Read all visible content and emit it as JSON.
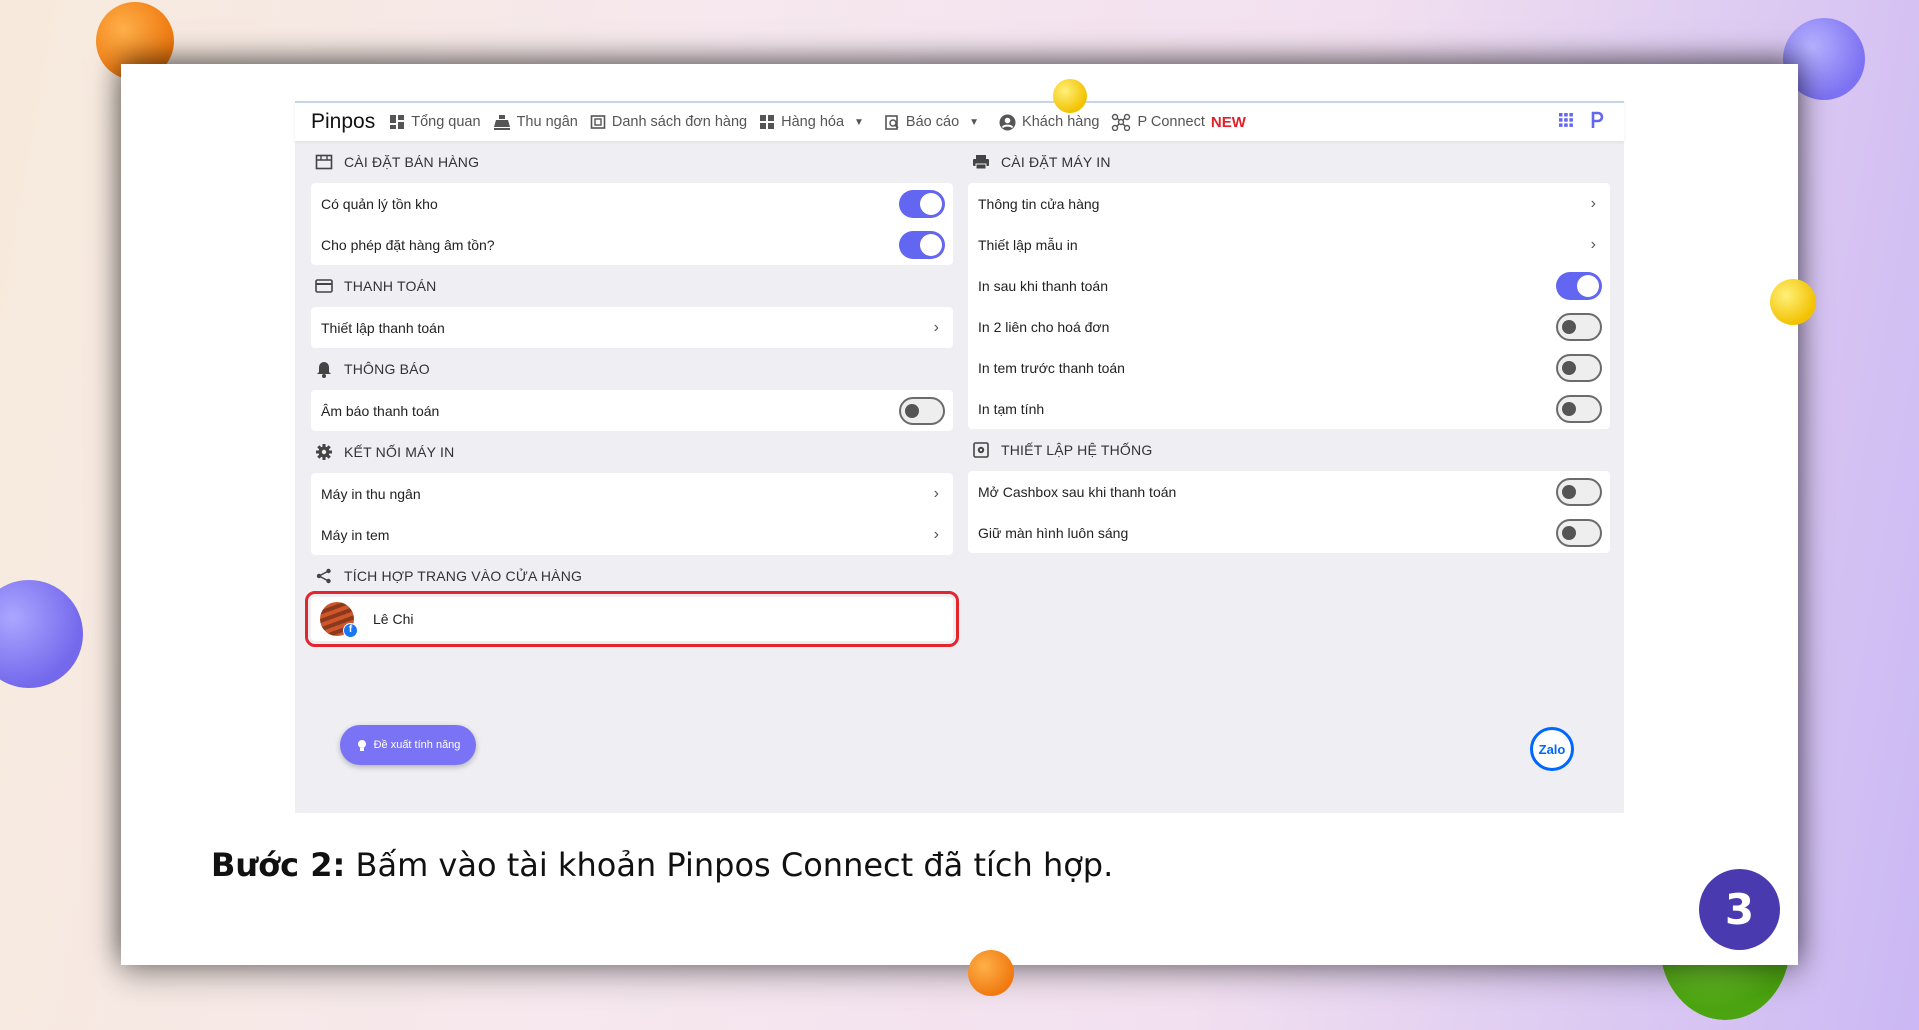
{
  "navbar": {
    "brand": "Pinpos",
    "items": [
      "Tổng quan",
      "Thu ngân",
      "Danh sách đơn hàng",
      "Hàng hóa",
      "Báo cáo",
      "Khách hàng",
      "P Connect"
    ],
    "new_badge": "NEW"
  },
  "left": {
    "sales": {
      "title": "CÀI ĐẶT BÁN HÀNG",
      "rows": [
        "Có quản lý tồn kho",
        "Cho phép đặt hàng âm tồn?"
      ]
    },
    "payment": {
      "title": "THANH TOÁN",
      "rows": [
        "Thiết lập thanh toán"
      ]
    },
    "notify": {
      "title": "THÔNG BÁO",
      "rows": [
        "Âm báo thanh toán"
      ]
    },
    "printer_conn": {
      "title": "KẾT NỐI MÁY IN",
      "rows": [
        "Máy in thu ngân",
        "Máy in tem"
      ]
    },
    "integration": {
      "title": "TÍCH HỢP TRANG VÀO CỬA HÀNG",
      "account": "Lê Chi"
    }
  },
  "right": {
    "printer": {
      "title": "CÀI ĐẶT MÁY IN",
      "rows": [
        "Thông tin cửa hàng",
        "Thiết lập mẫu in",
        "In sau khi thanh toán",
        "In 2 liên cho hoá đơn",
        "In tem trước thanh toán",
        "In tạm tính"
      ]
    },
    "system": {
      "title": "THIẾT LẬP HỆ THỐNG",
      "rows": [
        "Mở Cashbox sau khi thanh toán",
        "Giữ màn hình luôn sáng"
      ]
    }
  },
  "toggles": {
    "inventory": true,
    "negative_stock": true,
    "payment_sound": false,
    "print_after_pay": true,
    "print_two_copies": false,
    "print_label_before": false,
    "print_draft": false,
    "open_cashbox": false,
    "keep_screen_on": false
  },
  "feature_button": "Đề xuất tính năng",
  "zalo": "Zalo",
  "caption": {
    "bold": "Bước 2:",
    "text": " Bấm vào tài khoản Pinpos Connect đã tích hợp."
  },
  "page_number": "3",
  "colors": {
    "accent": "#6366f1",
    "highlight": "#e3262d",
    "new": "#e32028",
    "page_badge": "#4a3ab0"
  }
}
